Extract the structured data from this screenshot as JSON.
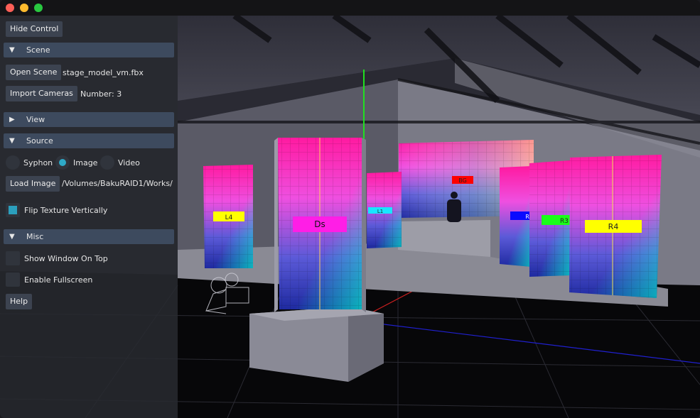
{
  "controls": {
    "hide_control": "Hide Control",
    "help": "Help"
  },
  "scene": {
    "header": "Scene",
    "open_scene": "Open Scene",
    "scene_file": "stage_model_vm.fbx",
    "import_cameras": "Import Cameras",
    "camera_count": "Number: 3"
  },
  "view": {
    "header": "View"
  },
  "source": {
    "header": "Source",
    "options": [
      "Syphon",
      "Image",
      "Video"
    ],
    "selected": "Image",
    "load_image": "Load Image",
    "image_path": "/Volumes/BakuRAID1/Works/",
    "flip_texture": "Flip Texture Vertically",
    "flip_texture_checked": true
  },
  "misc": {
    "header": "Misc",
    "show_on_top": "Show Window On Top",
    "show_on_top_checked": false,
    "fullscreen": "Enable Fullscreen",
    "fullscreen_checked": false
  },
  "viewport": {
    "screen_labels": {
      "ds": "Ds",
      "r4": "R4",
      "r3": "R3",
      "l4": "L4",
      "bg": "BG",
      "l1": "L1",
      "r_small": "R"
    },
    "label_colors": {
      "ds": "#ff1ee6",
      "r4": "#ffff00",
      "r3": "#19ff19",
      "l4": "#ffff00",
      "bg": "#ff0000",
      "l1": "#19e6ff",
      "r_small": "#0a0aff"
    }
  },
  "colors": {
    "panel_bg": "#282a30",
    "button_bg": "#3c4350",
    "header_bg": "#3d4a5e",
    "accent": "#2eaac8"
  }
}
